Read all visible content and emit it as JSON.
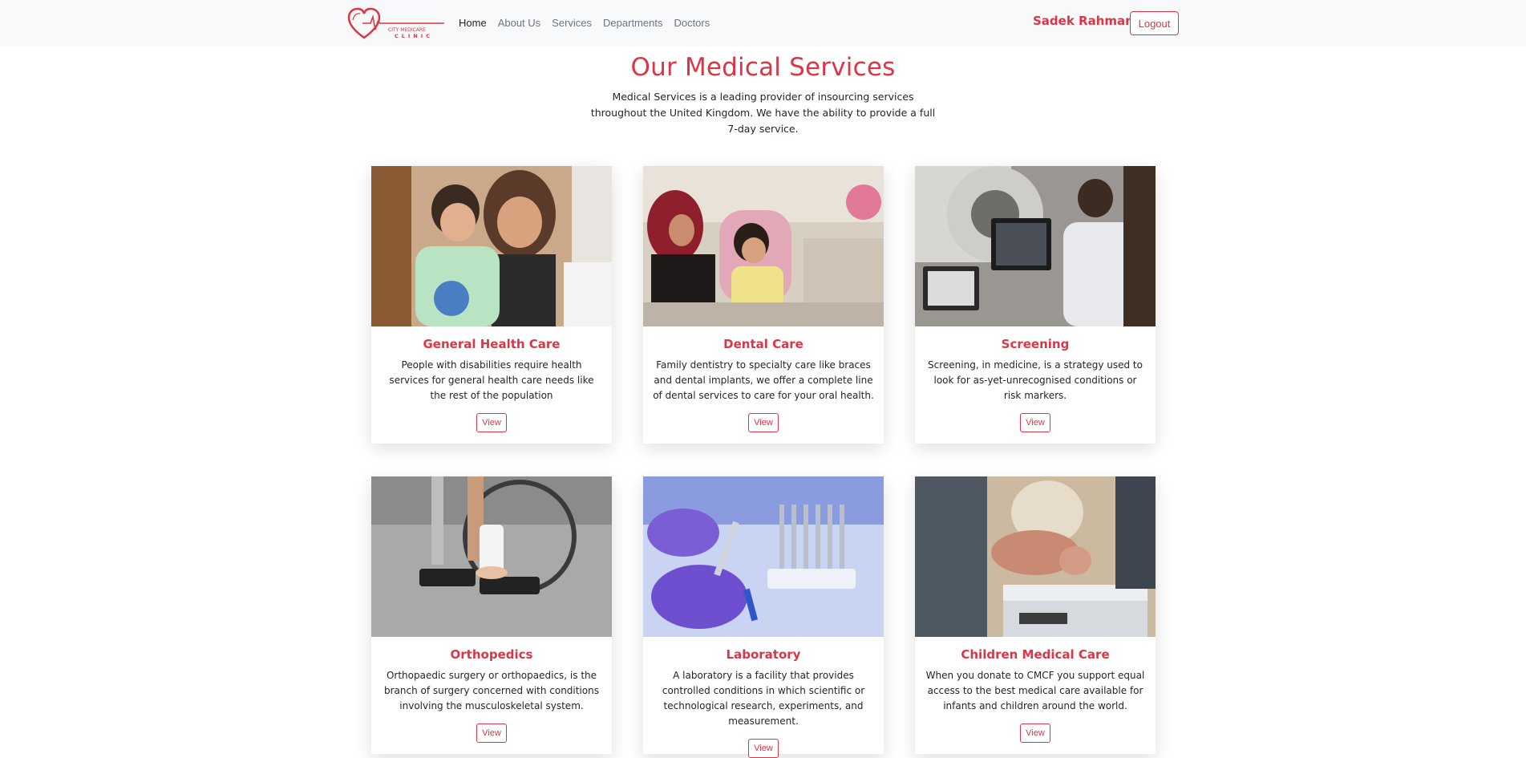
{
  "nav": {
    "brand_line1": "CITY MEDICARE",
    "brand_line2": "CLINIC",
    "links": [
      "Home",
      "About Us",
      "Services",
      "Departments",
      "Doctors"
    ],
    "user_name": "Sadek Rahman",
    "logout_label": "Logout"
  },
  "header": {
    "title": "Our Medical Services",
    "subtitle": "Medical Services is a leading provider of insourcing services throughout the United Kingdom. We have the ability to provide a full 7-day service."
  },
  "services": [
    {
      "title": "General Health Care",
      "text": "People with disabilities require health services for general health care needs like the rest of the population",
      "button": "View"
    },
    {
      "title": "Dental Care",
      "text": "Family dentistry to specialty care like braces and dental implants, we offer a complete line of dental services to care for your oral health.",
      "button": "View"
    },
    {
      "title": "Screening",
      "text": "Screening, in medicine, is a strategy used to look for as-yet-unrecognised conditions or risk markers.",
      "button": "View"
    },
    {
      "title": "Orthopedics",
      "text": "Orthopaedic surgery or orthopaedics, is the branch of surgery concerned with conditions involving the musculoskeletal system.",
      "button": "View"
    },
    {
      "title": "Laboratory",
      "text": "A laboratory is a facility that provides controlled conditions in which scientific or technological research, experiments, and measurement.",
      "button": "View"
    },
    {
      "title": "Children Medical Care",
      "text": "When you donate to CMCF you support equal access to the best medical care available for infants and children around the world.",
      "button": "View"
    }
  ],
  "colors": {
    "accent": "#dc3545",
    "navbar_bg": "#f8f9fa"
  }
}
